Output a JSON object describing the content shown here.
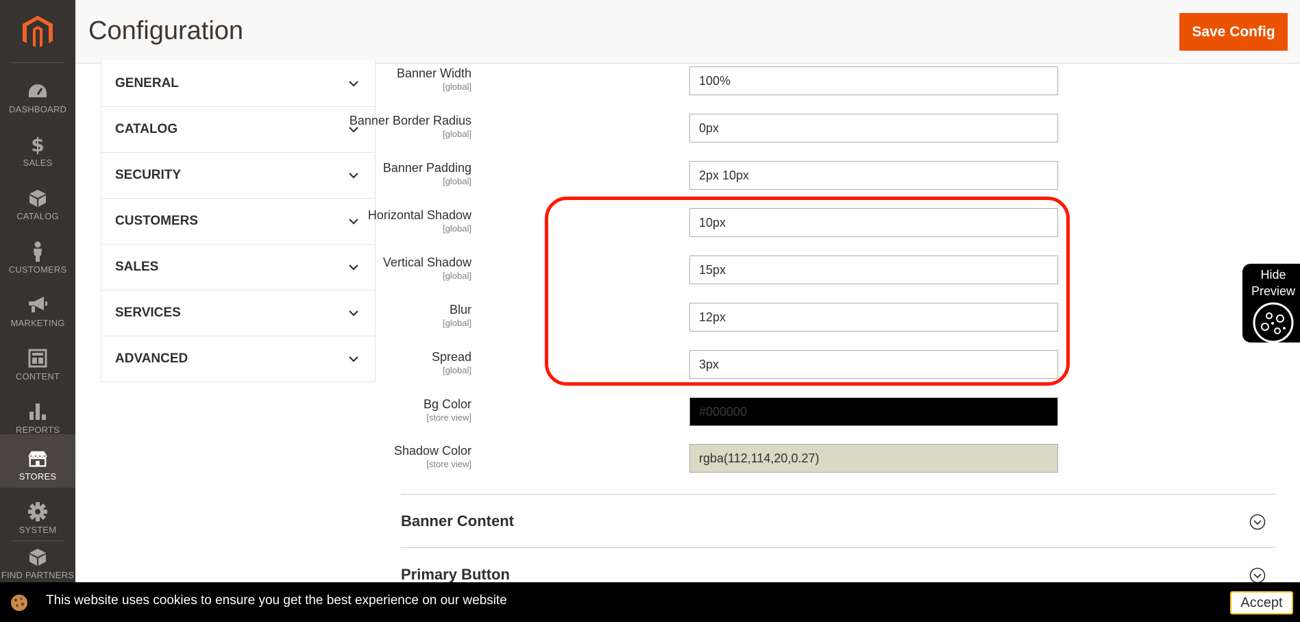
{
  "nav": {
    "items": [
      {
        "label": "DASHBOARD",
        "icon": "dashboard-icon"
      },
      {
        "label": "SALES",
        "icon": "dollar-icon"
      },
      {
        "label": "CATALOG",
        "icon": "box-icon"
      },
      {
        "label": "CUSTOMERS",
        "icon": "person-icon"
      },
      {
        "label": "MARKETING",
        "icon": "megaphone-icon"
      },
      {
        "label": "CONTENT",
        "icon": "layout-icon"
      },
      {
        "label": "REPORTS",
        "icon": "bar-chart-icon"
      },
      {
        "label": "STORES",
        "icon": "storefront-icon"
      },
      {
        "label": "SYSTEM",
        "icon": "gear-icon"
      },
      {
        "label": "FIND PARTNERS",
        "icon": "partners-box-icon"
      }
    ],
    "active": "STORES"
  },
  "header": {
    "title": "Configuration",
    "save_label": "Save Config"
  },
  "tabs": [
    {
      "label": "GENERAL"
    },
    {
      "label": "CATALOG"
    },
    {
      "label": "SECURITY"
    },
    {
      "label": "CUSTOMERS"
    },
    {
      "label": "SALES"
    },
    {
      "label": "SERVICES"
    },
    {
      "label": "ADVANCED"
    }
  ],
  "fields": [
    {
      "label": "Banner Width",
      "scope": "[global]",
      "value": "100%"
    },
    {
      "label": "Banner Border Radius",
      "scope": "[global]",
      "value": "0px"
    },
    {
      "label": "Banner Padding",
      "scope": "[global]",
      "value": "2px 10px"
    },
    {
      "label": "Horizontal Shadow",
      "scope": "[global]",
      "value": "10px"
    },
    {
      "label": "Vertical Shadow",
      "scope": "[global]",
      "value": "15px"
    },
    {
      "label": "Blur",
      "scope": "[global]",
      "value": "12px"
    },
    {
      "label": "Spread",
      "scope": "[global]",
      "value": "3px"
    },
    {
      "label": "Bg Color",
      "scope": "[store view]",
      "value": "#000000",
      "bg": "#000000",
      "text_color": "#3a3a3a"
    },
    {
      "label": "Shadow Color",
      "scope": "[store view]",
      "value": "rgba(112,114,20,0.27)",
      "bg": "#d9d9c4",
      "text_color": "#303030"
    }
  ],
  "sections": [
    {
      "title": "Banner Content"
    },
    {
      "title": "Primary Button"
    }
  ],
  "preview": {
    "line1": "Hide",
    "line2": "Preview"
  },
  "cookie": {
    "text": "This website uses cookies to ensure you get the best experience on our website",
    "accept_label": "Accept"
  },
  "colors": {
    "accent": "#eb5202",
    "nav_bg": "#373330",
    "highlight": "#ff1a00"
  }
}
